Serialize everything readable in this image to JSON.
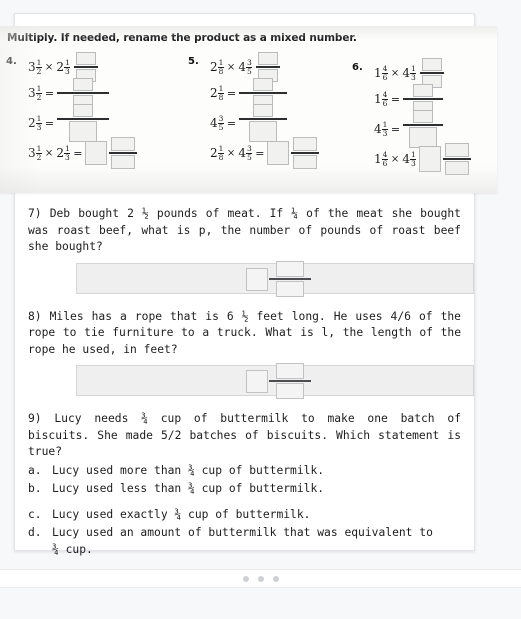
{
  "scan": {
    "directions": "Multiply. If needed, rename the product as a mixed number.",
    "problems": [
      {
        "number": "4.",
        "expression_whole_1": "3",
        "expression_num_1": "1",
        "expression_den_1": "2",
        "expression_whole_2": "2",
        "expression_num_2": "1",
        "expression_den_2": "3",
        "times": "×",
        "equals": "=",
        "line1_label_whole": "3",
        "line1_label_num": "1",
        "line1_label_den": "2",
        "line2_label_whole": "2",
        "line2_label_num": "1",
        "line2_label_den": "3"
      },
      {
        "number": "5.",
        "expression_whole_1": "2",
        "expression_num_1": "1",
        "expression_den_1": "8",
        "expression_whole_2": "4",
        "expression_num_2": "3",
        "expression_den_2": "5",
        "times": "×",
        "equals": "=",
        "line1_label_whole": "2",
        "line1_label_num": "1",
        "line1_label_den": "8",
        "line2_label_whole": "4",
        "line2_label_num": "3",
        "line2_label_den": "5"
      },
      {
        "number": "6.",
        "expression_whole_1": "1",
        "expression_num_1": "4",
        "expression_den_1": "6",
        "expression_whole_2": "4",
        "expression_num_2": "1",
        "expression_den_2": "3",
        "times": "×",
        "equals": "=",
        "line1_label_whole": "1",
        "line1_label_num": "4",
        "line1_label_den": "6",
        "line2_label_whole": "4",
        "line2_label_num": "1",
        "line2_label_den": "3"
      }
    ]
  },
  "questions": [
    {
      "id": "q7",
      "text": "7) Deb bought 2 ½ pounds of meat. If ¼ of the meat she bought was roast beef, what is p, the number of pounds of roast beef she bought?",
      "answer_value": ""
    },
    {
      "id": "q8",
      "text": "8) Miles has a rope that is 6 ½ feet long. He uses 4/6 of the rope to tie furniture to a truck. What is l, the length of the rope he used, in feet?",
      "answer_value": ""
    },
    {
      "id": "q9",
      "text": "9) Lucy needs ¾ cup of buttermilk to make one batch of biscuits. She made 5/2  batches of biscuits. Which statement is true?",
      "choices": [
        {
          "letter": "a.",
          "text": "Lucy used more than ¾ cup of buttermilk."
        },
        {
          "letter": "b.",
          "text": "Lucy used less than ¾ cup of buttermilk."
        },
        {
          "letter": "c.",
          "text": "Lucy used exactly ¾ cup of buttermilk."
        },
        {
          "letter": "d.",
          "text": "Lucy used an amount of buttermilk that was equivalent to",
          "text_cont": "¾ cup."
        }
      ]
    }
  ],
  "pagination": {
    "dot_count": 3,
    "active_index": 0
  },
  "colors": {
    "page_background": "#f7f8fa",
    "card_background": "#ffffff",
    "answer_field_background": "#efefef",
    "text": "#1d1d1f",
    "dot": "#cfd0d3"
  }
}
